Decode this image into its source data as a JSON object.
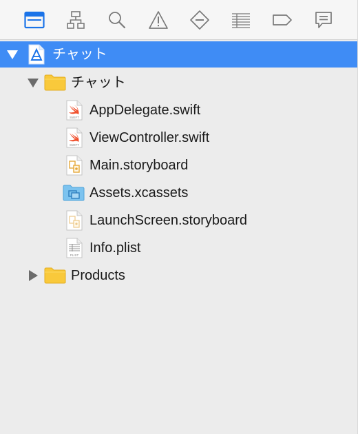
{
  "toolbar": {
    "items": [
      {
        "icon": "project-navigator-icon",
        "active": true
      },
      {
        "icon": "symbol-navigator-icon"
      },
      {
        "icon": "find-navigator-icon"
      },
      {
        "icon": "issue-navigator-icon"
      },
      {
        "icon": "test-navigator-icon"
      },
      {
        "icon": "debug-navigator-icon"
      },
      {
        "icon": "breakpoint-navigator-icon"
      },
      {
        "icon": "report-navigator-icon"
      }
    ]
  },
  "tree": {
    "project": {
      "label": "チャット",
      "expanded": true,
      "selected": true
    },
    "group": {
      "label": "チャット",
      "expanded": true
    },
    "files": [
      {
        "label": "AppDelegate.swift",
        "icon": "swift-file-icon"
      },
      {
        "label": "ViewController.swift",
        "icon": "swift-file-icon"
      },
      {
        "label": "Main.storyboard",
        "icon": "storyboard-file-icon"
      },
      {
        "label": "Assets.xcassets",
        "icon": "asset-catalog-icon"
      },
      {
        "label": "LaunchScreen.storyboard",
        "icon": "storyboard-file-icon"
      },
      {
        "label": "Info.plist",
        "icon": "plist-file-icon"
      }
    ],
    "products": {
      "label": "Products",
      "expanded": false
    },
    "swift_badge": "SWIFT",
    "plist_badge": "PLIST"
  },
  "colors": {
    "selection": "#3f8cf5",
    "active_icon": "#1a73e8",
    "folder": "#f9c93b",
    "swift": "#f0512e"
  }
}
